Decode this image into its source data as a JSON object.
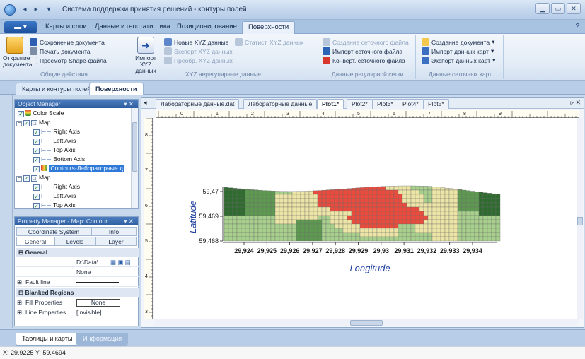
{
  "window": {
    "title": "Система поддержки принятия решений - контуры полей"
  },
  "ribbon": {
    "tabs": [
      "Карты и слои",
      "Данные и геостатистика",
      "Позиционирование",
      "Поверхности"
    ],
    "active_tab": "Поверхности",
    "groups": {
      "general": {
        "label": "Общие действия",
        "open_doc": "Открытие документа",
        "save_doc": "Сохранение документа",
        "print_doc": "Печать документа",
        "shape_view": "Просмотр Shape-файла"
      },
      "xyz_irregular": {
        "label": "XYZ нерегулярные данные",
        "import_xyz": "Импорт XYZ данных",
        "new_xyz": "Новые XYZ данные",
        "stat_xyz": "Статист. XYZ данных",
        "export_xyz": "Экспорт XYZ данных",
        "transform_xyz": "Преобр. XYZ данных"
      },
      "grid": {
        "label": "Данные регулярной сетки",
        "create_grid": "Создание сеточного файла",
        "import_grid": "Импорт сеточного файла",
        "convert_grid": "Конверт. сеточного файла"
      },
      "grid_maps": {
        "label": "Данные сеточных карт",
        "create_doc": "Создание документа",
        "import_maps": "Импорт данных карт",
        "export_maps": "Экспорт данных карт"
      }
    }
  },
  "document_tabs": [
    "Карты и контуры полей",
    "Поверхности"
  ],
  "document_tabs_active": "Поверхности",
  "object_manager": {
    "title": "Object Manager",
    "items": [
      {
        "label": "Color Scale"
      },
      {
        "label": "Map"
      },
      {
        "label": "Right Axis"
      },
      {
        "label": "Left Axis"
      },
      {
        "label": "Top Axis"
      },
      {
        "label": "Bottom Axis"
      },
      {
        "label": "Contours-Лабораторные д"
      },
      {
        "label": "Map"
      },
      {
        "label": "Right Axis"
      },
      {
        "label": "Left Axis"
      },
      {
        "label": "Top Axis"
      }
    ]
  },
  "property_manager": {
    "title": "Property Manager - Map: Contour...",
    "tabs_row1": [
      "Coordinate System",
      "Info"
    ],
    "tabs_row2": [
      "General",
      "Levels",
      "Layer"
    ],
    "active_tab": "General",
    "section_general": "General",
    "file_path": "D:\\Data\\...",
    "none_value": "None",
    "fault_line": "Fault line",
    "section_blanked": "Blanked Regions",
    "fill_properties": "Fill Properties",
    "fill_value": "None",
    "line_properties": "Line Properties",
    "line_value": "[Invisible]"
  },
  "plot_tabs": {
    "items": [
      "Лабораторные данные.dat",
      "Лабораторные данные",
      "Plot1*",
      "Plot2*",
      "Plot3*",
      "Plot4*",
      "Plot5*"
    ],
    "active": "Plot1*"
  },
  "chart_data": {
    "type": "heatmap",
    "xlabel": "Longitude",
    "ylabel": "Latitude",
    "x_ticks": [
      "29,924",
      "29,925",
      "29,926",
      "29,927",
      "29,928",
      "29,929",
      "29,93",
      "29,931",
      "29,932",
      "29,933",
      "29,934"
    ],
    "y_ticks": [
      "59,47",
      "59,469",
      "59,468"
    ],
    "ruler_top_labels": [
      "0",
      "1",
      "2",
      "3",
      "4",
      "5",
      "6",
      "7",
      "8",
      "9"
    ],
    "ruler_left_labels": [
      "8",
      "7",
      "6",
      "5",
      "4",
      "3"
    ],
    "zones": [
      {
        "name": "low",
        "color": "#2e6b2e"
      },
      {
        "name": "low-mid",
        "color": "#5d9a4f"
      },
      {
        "name": "mid",
        "color": "#a8d08d"
      },
      {
        "name": "mid-high",
        "color": "#ede5a6"
      },
      {
        "name": "high",
        "color": "#ea4b3c"
      }
    ],
    "colors": {
      "grid_line": "#6b6b6b",
      "axis_text": "#1a1a1a",
      "title_blue": "#1f3f9e"
    }
  },
  "bottom_tabs": [
    "Таблицы и карты",
    "Информация"
  ],
  "status": {
    "coords": "X: 29.9225  Y: 59.4694"
  }
}
